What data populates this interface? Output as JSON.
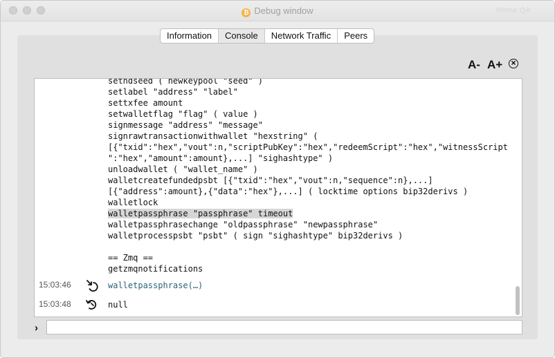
{
  "window": {
    "title": "Debug window",
    "title_right": "Home QA"
  },
  "tabs": [
    {
      "label": "Information",
      "active": false
    },
    {
      "label": "Console",
      "active": true
    },
    {
      "label": "Network Traffic",
      "active": false
    },
    {
      "label": "Peers",
      "active": false
    }
  ],
  "toolbar": {
    "font_smaller_label": "A-",
    "font_larger_label": "A+",
    "clear_icon": "clear-circle-x-icon"
  },
  "console": {
    "help_lines": [
      "sethdseed ( newkeypool \"seed\" )",
      "setlabel \"address\" \"label\"",
      "settxfee amount",
      "setwalletflag \"flag\" ( value )",
      "signmessage \"address\" \"message\"",
      "signrawtransactionwithwallet \"hexstring\" (",
      "[{\"txid\":\"hex\",\"vout\":n,\"scriptPubKey\":\"hex\",\"redeemScript\":\"hex\",\"witnessScript",
      "\":\"hex\",\"amount\":amount},...] \"sighashtype\" )",
      "unloadwallet ( \"wallet_name\" )",
      "walletcreatefundedpsbt [{\"txid\":\"hex\",\"vout\":n,\"sequence\":n},...]",
      "[{\"address\":amount},{\"data\":\"hex\"},...] ( locktime options bip32derivs )",
      "walletlock",
      "walletpassphrase \"passphrase\" timeout",
      "walletpassphrasechange \"oldpassphrase\" \"newpassphrase\"",
      "walletprocesspsbt \"psbt\" ( sign \"sighashtype\" bip32derivs )",
      "",
      "== Zmq ==",
      "getzmqnotifications"
    ],
    "highlighted_line": "walletpassphrase \"passphrase\" timeout",
    "entries": [
      {
        "time": "15:03:46",
        "icon": "command-in-icon",
        "text": "walletpassphrase(…)",
        "color": "#2a6478"
      },
      {
        "time": "15:03:48",
        "icon": "reply-out-icon",
        "text": "null",
        "color": "#111111"
      }
    ]
  },
  "input": {
    "prompt_icon": "chevron-right-icon",
    "value": "",
    "placeholder": ""
  }
}
